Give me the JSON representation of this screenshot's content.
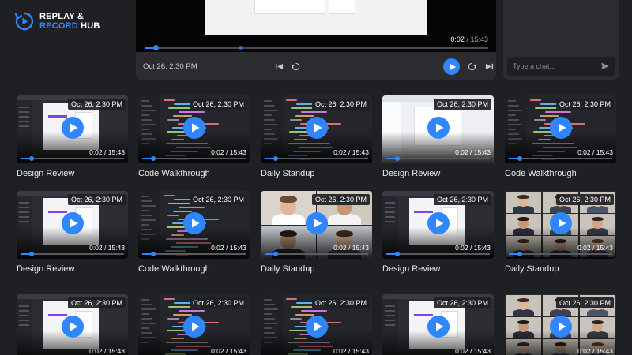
{
  "brand": {
    "line1": "REPLAY &",
    "line2a": "RECORD",
    "line2b": "HUB",
    "accent": "#2f86ff"
  },
  "player": {
    "time_current": "0:02",
    "time_sep": " / ",
    "time_total": "15:43",
    "date": "Oct 26, 2:30 PM",
    "progress": 0.03,
    "icons": [
      "skip-back-icon",
      "rewind-10-icon",
      "play-icon",
      "forward-10-icon",
      "skip-forward-icon",
      "captions-icon",
      "volume-icon",
      "chat-icon",
      "more-icon"
    ]
  },
  "chat": {
    "placeholder": "Type a chat..."
  },
  "cards": [
    {
      "title": "Design Review",
      "date": "Oct 26, 2:30 PM",
      "time": "0:02 / 15:43",
      "scene": "design"
    },
    {
      "title": "Code Walkthrough",
      "date": "Oct 26, 2:30 PM",
      "time": "0:02 / 15:43",
      "scene": "code"
    },
    {
      "title": "Daily Standup",
      "date": "Oct 26, 2:30 PM",
      "time": "0:02 / 15:43",
      "scene": "code"
    },
    {
      "title": "Design Review",
      "date": "Oct 26, 2:30 PM",
      "time": "0:02 / 15:43",
      "scene": "light"
    },
    {
      "title": "Code Walkthrough",
      "date": "Oct 26, 2:30 PM",
      "time": "0:02 / 15:43",
      "scene": "code"
    },
    {
      "title": "Design Review",
      "date": "Oct 26, 2:30 PM",
      "time": "0:02 / 15:43",
      "scene": "design"
    },
    {
      "title": "Code Walkthrough",
      "date": "Oct 26, 2:30 PM",
      "time": "0:02 / 15:43",
      "scene": "code"
    },
    {
      "title": "Daily Standup",
      "date": "Oct 26, 2:30 PM",
      "time": "0:02 / 15:43",
      "scene": "people"
    },
    {
      "title": "Design Review",
      "date": "Oct 26, 2:30 PM",
      "time": "0:02 / 15:43",
      "scene": "design"
    },
    {
      "title": "Daily Standup",
      "date": "Oct 26, 2:30 PM",
      "time": "0:02 / 15:43",
      "scene": "people6"
    },
    {
      "title": "",
      "date": "Oct 26, 2:30 PM",
      "time": "0:02 / 15:43",
      "scene": "design"
    },
    {
      "title": "",
      "date": "Oct 26, 2:30 PM",
      "time": "0:02 / 15:43",
      "scene": "code"
    },
    {
      "title": "",
      "date": "Oct 26, 2:30 PM",
      "time": "0:02 / 15:43",
      "scene": "code"
    },
    {
      "title": "",
      "date": "Oct 26, 2:30 PM",
      "time": "0:02 / 15:43",
      "scene": "design"
    },
    {
      "title": "",
      "date": "Oct 26, 2:30 PM",
      "time": "0:02 / 15:43",
      "scene": "people6"
    }
  ]
}
